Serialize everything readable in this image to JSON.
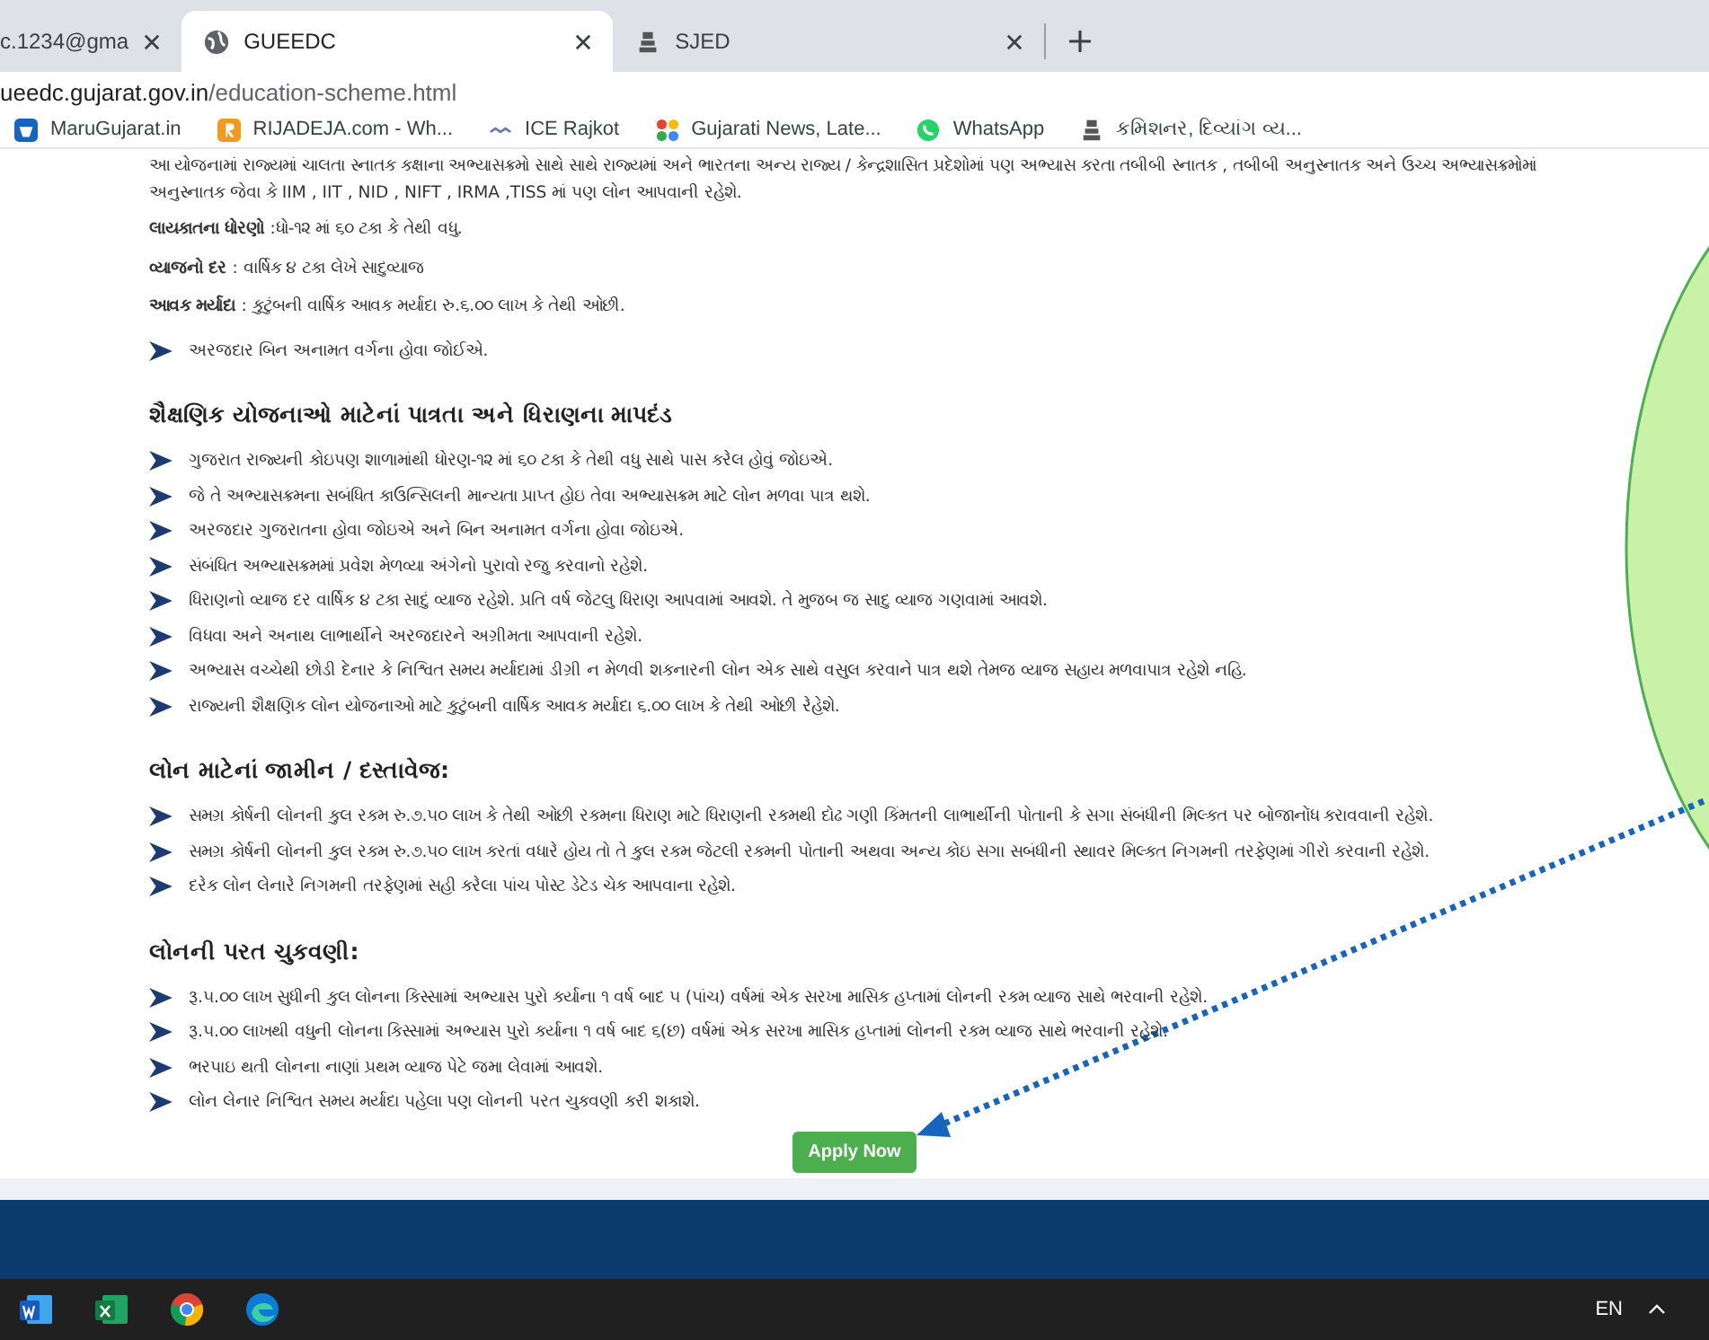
{
  "browser": {
    "tabs": [
      {
        "title": "c.1234@gma",
        "selected": false
      },
      {
        "title": "GUEEDC",
        "selected": true,
        "kind": "globe"
      },
      {
        "title": "SJED",
        "selected": false,
        "kind": "emblem"
      }
    ],
    "address": {
      "host": "ueedc.gujarat.gov.in",
      "path": "/education-scheme.html"
    },
    "bookmarks": [
      {
        "label": "MaruGujarat.in",
        "kind": "blue"
      },
      {
        "label": "RIJADEJA.com - Wh...",
        "kind": "orange"
      },
      {
        "label": "ICE Rajkot",
        "kind": "ice"
      },
      {
        "label": "Gujarati News, Late...",
        "kind": "dots"
      },
      {
        "label": "WhatsApp",
        "kind": "whatsapp"
      },
      {
        "label": "કમિશનર, દિવ્યાંગ વ્ય...",
        "kind": "emblem"
      }
    ]
  },
  "page": {
    "intro": "આ યોજનામાં રાજ્યમાં ચાલતા સ્નાતક કક્ષાના અભ્યાસક્રમો સાથે સાથે રાજ્યમાં અને ભારતના અન્ય રાજ્ય / કેન્દ્રશાસિત પ્રદેશોમાં પણ અભ્યાસ કરતા તબીબી સ્નાતક , તબીબી અનુસ્નાતક અને ઉચ્ચ અભ્યાસક્રમોમાં અનુસ્નાતક જેવા કે IIM , IIT , NID , NIFT , IRMA ,TISS માં પણ લોન આપવાની રહેશે.",
    "facts": [
      "**લાયકાતના ધોરણો** :ધો-૧૨ માં ૬૦ ટકા કે તેથી વધુ.",
      "**વ્યાજનો દર** : વાર્ષિક ૪ ટકા લેખે સાદુવ્યાજ",
      "**આવક મર્યાદા** : કુટુંબની વાર્ષિક આવક મર્યાદા રુ.૬.૦૦ લાખ કે તેથી ઓછી."
    ],
    "note": "અરજદાર બિન અનામત વર્ગના હોવા જોઈએ.",
    "sections": [
      {
        "heading": "શૈક્ષણિક યોજનાઓ માટેનાં પાત્રતા અને ધિરાણના માપદંડ",
        "items": [
          "ગુજરાત રાજ્યની કોઇપણ શાળામાંથી ધોરણ-૧૨ માં ૬૦ ટકા કે તેથી વધુ સાથે પાસ કરેલ હોવું જોઇએ.",
          "જે તે અભ્યાસક્રમના સબંધિત કાઉન્સિલની માન્યતા પ્રાપ્ત હોઇ તેવા અભ્યાસક્રમ માટે લોન મળવા પાત્ર થશે.",
          "અરજદાર ગુજરાતના હોવા જોઇએ અને બિન અનામત વર્ગના હોવા જોઇએ.",
          "સંબંધિત અભ્યાસક્રમમાં પ્રવેશ મેળવ્યા અંગેનો પુરાવો રજુ કરવાનો રહેશે.",
          "ધિરાણનો વ્યાજ દર વાર્ષિક ૪ ટકા સાદું વ્યાજ રહેશે. પ્રતિ વર્ષ જેટલુ ધિરાણ આપવામાં આવશે. તે મુજબ જ સાદુ વ્યાજ ગણવામાં આવશે.",
          "વિધવા અને અનાથ લાભાર્થીને અરજદારને અગ્રીમતા આપવાની રહેશે.",
          "અભ્યાસ વચ્ચેથી છોડી દેનાર કે નિશ્વિત સમય મર્યાદામાં ડીગ્રી ન મેળવી શકનારની લોન એક સાથે વસુલ કરવાને પાત્ર થશે તેમજ વ્યાજ સહાય મળવાપાત્ર રહેશે નહિ.",
          "રાજ્યની શૈક્ષણિક લોન યોજનાઓ માટે કુટુંબની વાર્ષિક આવક મર્યાદા ૬.૦૦ લાખ કે તેથી ઓછી રેહેશે."
        ]
      },
      {
        "heading": "લોન માટેનાં જામીન / દસ્તાવેજ:",
        "items": [
          "સમગ્ર કોર્ષની લોનની કુલ રકમ રુ.૭.૫૦ લાખ કે તેથી ઓછી રકમના ધિરાણ માટે ધિરાણની રકમથી દોઢ ગણી કિંમતની લાભાર્થીની પોતાની કે સગા સંબંધીની મિલ્કત પર બોજાનોંધ કરાવવાની રહેશે.",
          "સમગ્ર કોર્ષની લોનની કુલ રકમ રુ.૭.૫૦ લાખ કરતાં વધારે હોય તો તે કુલ રકમ જેટલી રકમની પોતાની અથવા અન્ય કોઇ સગા સબંધીની સ્થાવર મિલ્કત નિગમની તરફેણમાં ગીરો કરવાની રહેશે.",
          "દરેક લોન લેનારે નિગમની તરફેણમાં સહી કરેલા પાંચ પોસ્ટ ડેટેડ ચેક આપવાના રહેશે."
        ]
      },
      {
        "heading": "લોનની પરત ચુકવણી:",
        "items": [
          "રૂ.૫.૦૦ લાખ સુધીની કુલ લોનના કિસ્સામાં અભ્યાસ પુરો કર્યાના ૧ વર્ષ બાદ ૫ (પાંચ) વર્ષમાં એક સરખા માસિક હપ્તામાં લોનની રકમ વ્યાજ સાથે ભરવાની રહેશે.",
          "રૂ.૫.૦૦ લાખથી વધુની લોનના કિસ્સામાં અભ્યાસ પુરો કર્યાના ૧ વર્ષ બાદ ૬(છ) વર્ષમાં એક સરખા માસિક હપ્તામાં લોનની રકમ વ્યાજ સાથે ભરવાની રહેશે.",
          "ભરપાઇ થતી લોનના નાણાં પ્રથમ વ્યાજ પેટે જમા લેવામાં આવશે.",
          "લોન લેનાર નિશ્વિત સમય મર્યાદા પહેલા પણ લોનની પરત ચુકવણી કરી શકાશે."
        ]
      }
    ],
    "apply_button": "Apply Now"
  },
  "taskbar": {
    "apps": [
      {
        "kind": "word"
      },
      {
        "kind": "excel"
      },
      {
        "kind": "chrome"
      },
      {
        "kind": "edge"
      }
    ],
    "language": "EN"
  }
}
